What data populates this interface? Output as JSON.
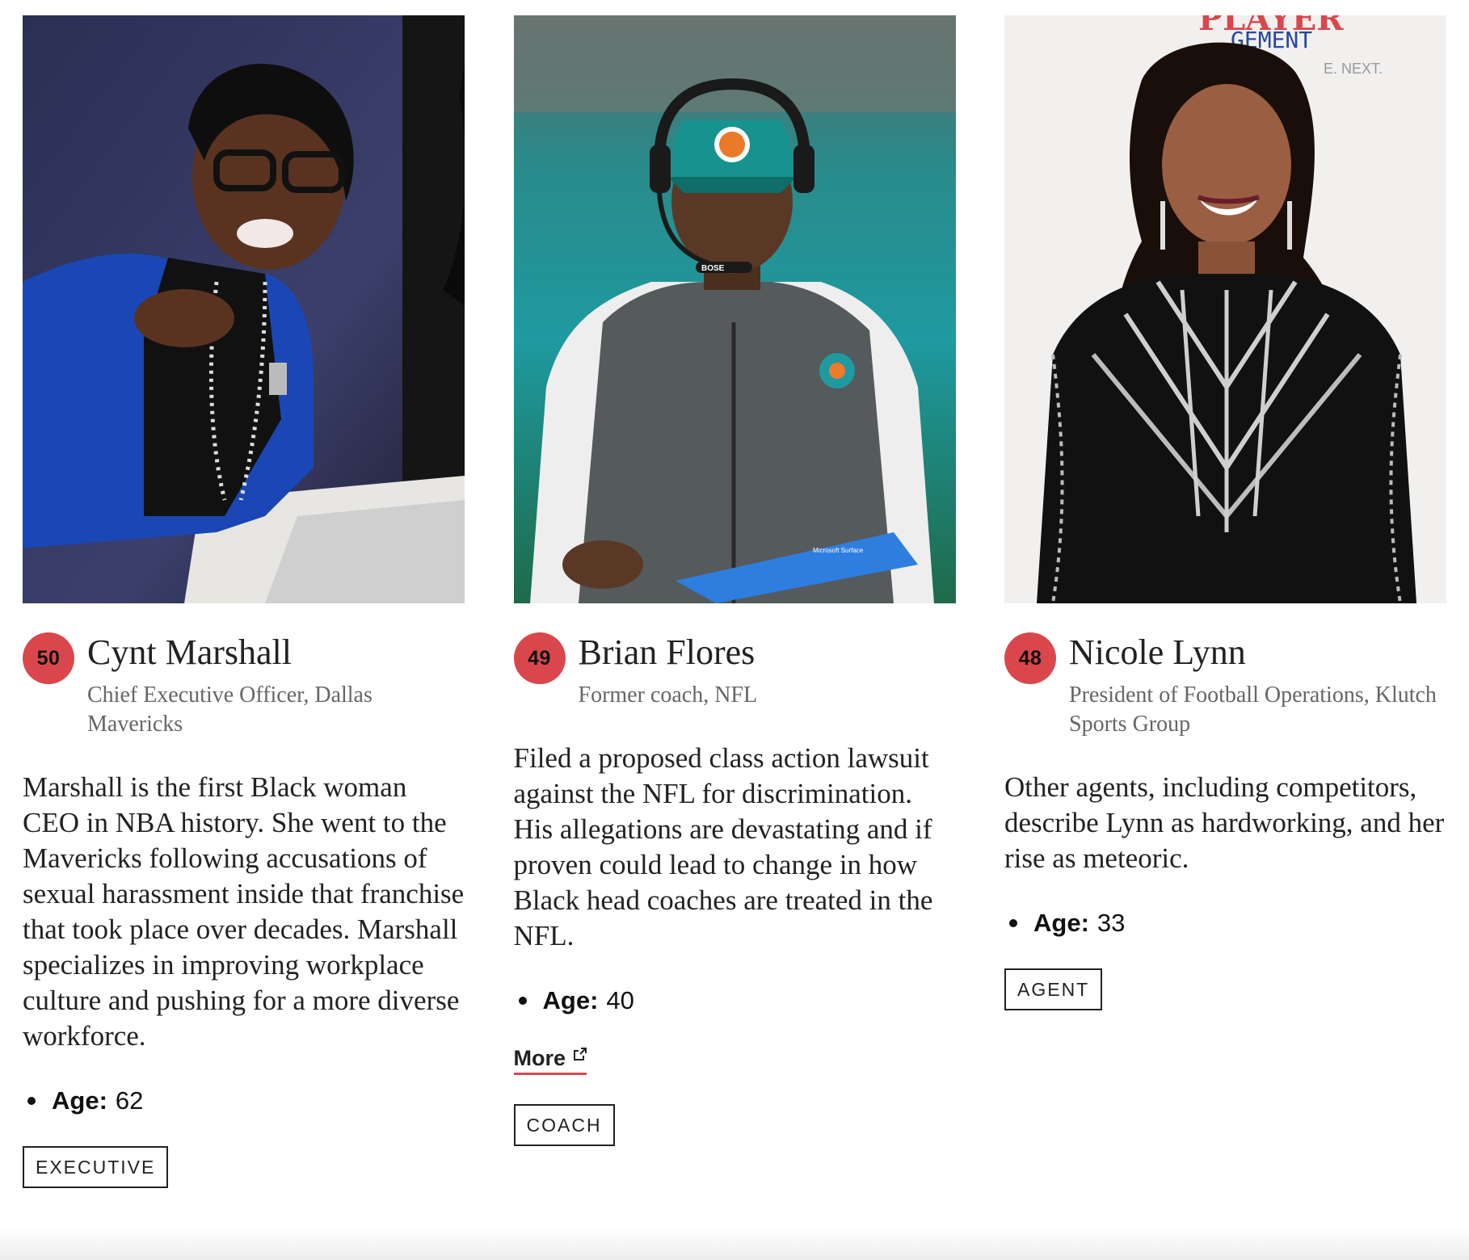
{
  "profiles": [
    {
      "rank": "50",
      "name": "Cynt Marshall",
      "role": "Chief Executive Officer, Dallas Mavericks",
      "description": "Marshall is the first Black woman CEO in NBA history. She went to the Mavericks following accusations of sexual harassment inside that franchise that took place over decades. Marshall specializes in improving workplace culture and pushing for a more diverse workforce.",
      "age_label": "Age:",
      "age": "62",
      "tag": "EXECUTIVE"
    },
    {
      "rank": "49",
      "name": "Brian Flores",
      "role": "Former coach, NFL",
      "description": "Filed a proposed class action lawsuit against the NFL for discrimination. His allegations are devastating and if proven could lead to change in how Black head coaches are treated in the NFL.",
      "age_label": "Age:",
      "age": "40",
      "more_label": "More",
      "tag": "COACH"
    },
    {
      "rank": "48",
      "name": "Nicole Lynn",
      "role": "President of Football Operations, Klutch Sports Group",
      "description": "Other agents, including competitors, describe Lynn as hardworking, and her rise as meteoric.",
      "age_label": "Age:",
      "age": "33",
      "tag": "AGENT"
    }
  ],
  "photo_backdrop_text": {
    "line1": "PLAYER",
    "line2": "GEMENT",
    "line3": "E. NEXT."
  },
  "photo_logo_text": {
    "headset": "BOSE",
    "tablet": "Microsoft Surface"
  },
  "colors": {
    "accent": "#d9474d",
    "text": "#222222",
    "muted": "#666666"
  },
  "icons": {
    "external_link": "external-link-icon"
  }
}
